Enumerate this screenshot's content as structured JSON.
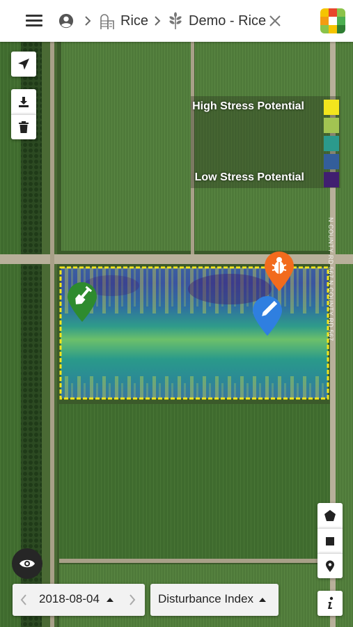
{
  "header": {
    "breadcrumb_farm": "Rice",
    "breadcrumb_field": "Demo - Rice"
  },
  "legend": {
    "high_label": "High Stress Potential",
    "low_label": "Low Stress Potential",
    "colors": [
      "#f3e51d",
      "#a2c452",
      "#2b9a8c",
      "#335e9b",
      "#401f70"
    ]
  },
  "road_label": "N COUNTY RD 567 N COUNTY RD 567",
  "date_selector": {
    "value": "2018-08-04"
  },
  "layer_selector": {
    "value": "Disturbance Index"
  },
  "icons": {
    "menu": "hamburger-menu-icon",
    "user": "account-circle-icon",
    "farm": "silo-icon",
    "field": "crop-icon",
    "close": "close-icon",
    "locate": "navigation-arrow-icon",
    "download": "download-icon",
    "delete": "trash-icon",
    "polygon": "pentagon-icon",
    "rectangle": "square-icon",
    "marker": "map-pin-icon",
    "info": "info-icon",
    "visibility": "eye-icon",
    "soil_sample": "shovel-pin-icon",
    "pest": "bug-pin-icon",
    "note": "pencil-pin-icon"
  }
}
